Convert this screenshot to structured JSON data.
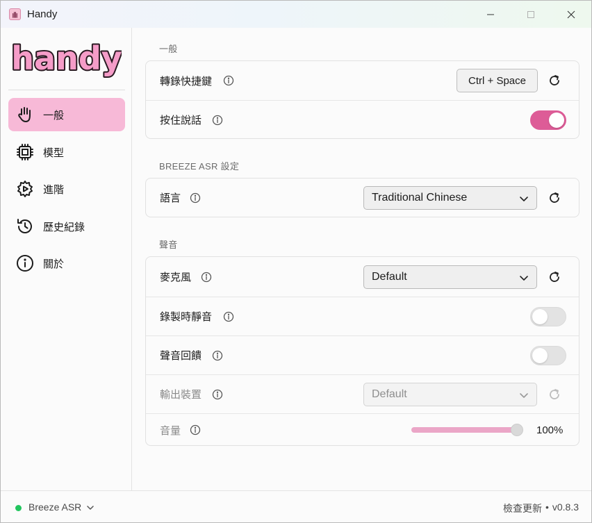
{
  "window": {
    "title": "Handy",
    "icons": {
      "app": "hand-icon",
      "minimize": "minimize-icon",
      "maximize": "maximize-icon",
      "close": "close-icon"
    }
  },
  "sidebar": {
    "logo_text": "handy",
    "items": [
      {
        "label": "一般",
        "icon": "hand-icon",
        "active": true
      },
      {
        "label": "模型",
        "icon": "chip-icon",
        "active": false
      },
      {
        "label": "進階",
        "icon": "gear-play-icon",
        "active": false
      },
      {
        "label": "歷史紀錄",
        "icon": "history-icon",
        "active": false
      },
      {
        "label": "關於",
        "icon": "info-icon",
        "active": false
      }
    ]
  },
  "main": {
    "general": {
      "title": "一般",
      "shortcut": {
        "label": "轉錄快捷鍵",
        "value": "Ctrl + Space"
      },
      "push_to_talk": {
        "label": "按住說話",
        "enabled": true
      }
    },
    "asr": {
      "title": "BREEZE ASR 設定",
      "language": {
        "label": "語言",
        "value": "Traditional Chinese"
      }
    },
    "sound": {
      "title": "聲音",
      "microphone": {
        "label": "麥克風",
        "value": "Default"
      },
      "mute_while_recording": {
        "label": "錄製時靜音",
        "enabled": false
      },
      "audio_feedback": {
        "label": "聲音回饋",
        "enabled": false
      },
      "output_device": {
        "label": "輸出裝置",
        "value": "Default",
        "disabled": true
      },
      "volume": {
        "label": "音量",
        "value_text": "100%",
        "fraction": 1.0
      }
    }
  },
  "footer": {
    "model_name": "Breeze ASR",
    "status_color": "#22c55e",
    "check_updates": "檢查更新",
    "separator": "•",
    "version": "v0.8.3"
  },
  "colors": {
    "accent": "#dd5c97",
    "active_nav": "#f7b9d7",
    "slider_fill": "#eba6c7"
  }
}
